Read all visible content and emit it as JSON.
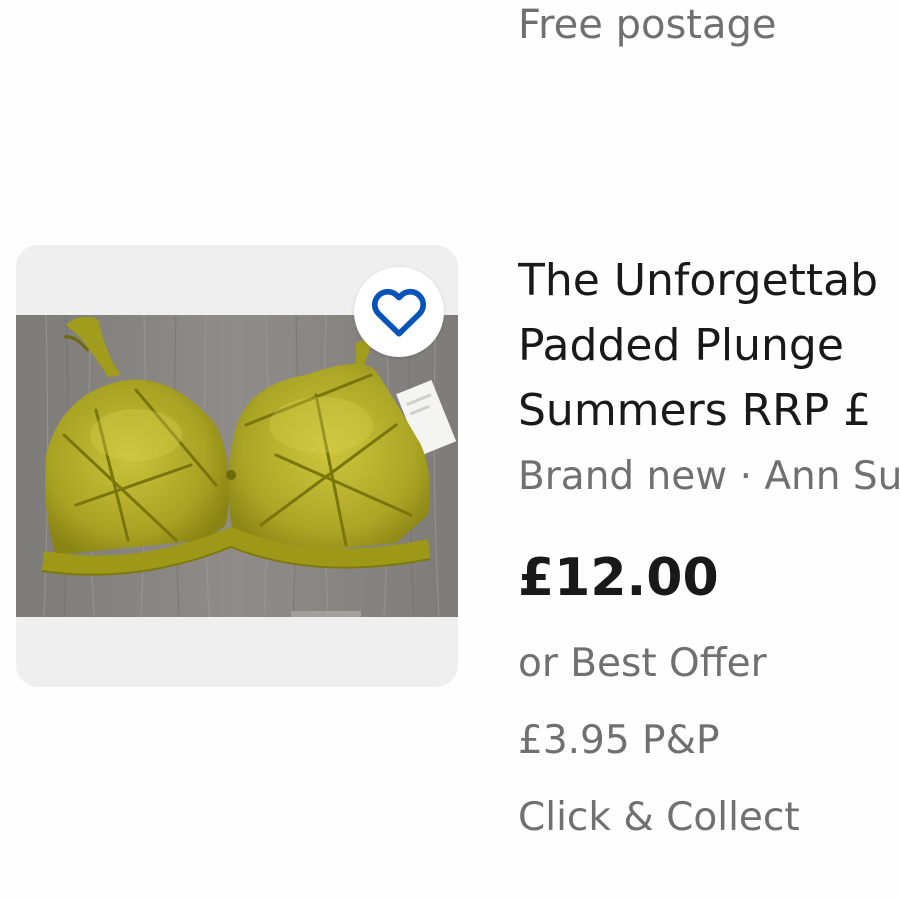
{
  "previous_listing": {
    "postage": "Free postage"
  },
  "listing": {
    "title_lines": [
      "The Unforgettab",
      "Padded Plunge",
      "Summers RRP £"
    ],
    "subtitle": "Brand new · Ann Su",
    "price": "£12.00",
    "offer": "or Best Offer",
    "postage": "£3.95 P&P",
    "collection": "Click & Collect",
    "watch_icon": "heart-outline-icon"
  },
  "colors": {
    "title_text": "#191919",
    "secondary_text": "#707070",
    "thumbnail_bg": "#efefef",
    "heart": "#0654ba"
  }
}
